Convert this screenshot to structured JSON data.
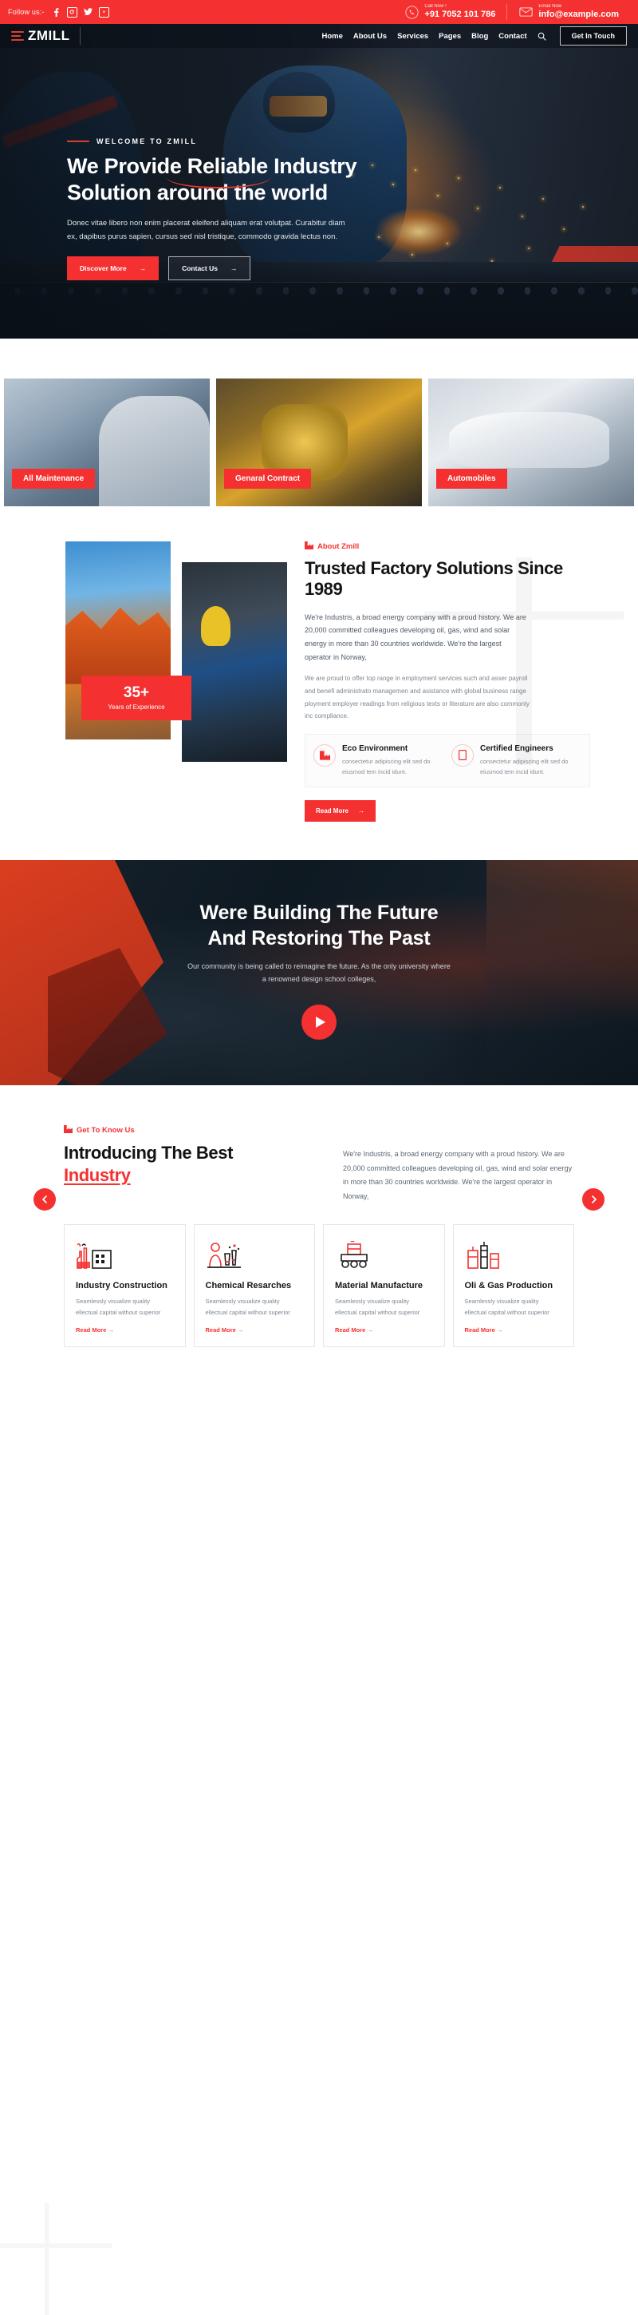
{
  "topbar": {
    "follow_label": "Follow us:-",
    "socials": [
      {
        "name": "facebook-icon",
        "glyph": "f"
      },
      {
        "name": "instagram-icon",
        "glyph": "◎"
      },
      {
        "name": "twitter-icon",
        "glyph": "🐦"
      },
      {
        "name": "youtube-icon",
        "glyph": "▶"
      }
    ],
    "call": {
      "icon": "phone-icon",
      "label": "Call Now !",
      "value": "+91 7052 101 786"
    },
    "email": {
      "icon": "envelope-icon",
      "label": "Email Now",
      "value": "info@example.com"
    }
  },
  "nav": {
    "logo": "ZMILL",
    "links": [
      "Home",
      "About Us",
      "Services",
      "Pages",
      "Blog",
      "Contact"
    ],
    "search_icon": "search-icon",
    "cta": "Get In Touch"
  },
  "hero": {
    "eyebrow": "WELCOME TO ZMILL",
    "title_line1": "We Provide Reliable Industry",
    "title_line2": "Solution around the world",
    "desc": "Donec vitae libero non enim placerat eleifend aliquam erat volutpat. Curabitur diam ex, dapibus purus sapien, cursus sed nisl tristique, commodo gravida lectus non.",
    "btn_primary": "Discover More",
    "btn_ghost": "Contact Us",
    "arrow": "→"
  },
  "strip": [
    {
      "label": "All Maintenance"
    },
    {
      "label": "Genaral Contract"
    },
    {
      "label": "Automobiles"
    }
  ],
  "about": {
    "eyebrow": "About Zmill",
    "eyebrow_icon": "factory-icon",
    "heading": "Trusted Factory Solutions Since 1989",
    "p1": "We're Industris, a broad energy company with a proud history. We are 20,000 committed colleagues developing oil, gas, wind and solar energy in more than 30 countries worldwide. We're the largest operator in Norway,",
    "p2": "We are proud to offer top range in employment services such and asser payroll and benefi administrato managemen and asistance with global business range ployment employer readings from religious texts or literature are also commonly inc compliance.",
    "badge_number": "35+",
    "badge_text": "Years of Experience",
    "features": [
      {
        "icon": "eco-factory-icon",
        "title": "Eco Environment",
        "desc": "consectetur adipiscing elit sed do eiusmod tem incid idunt."
      },
      {
        "icon": "certificate-icon",
        "title": "Certified Engineers",
        "desc": "consectetur adipiscing elit sed do eiusmod tem incid idunt."
      }
    ],
    "read_more": "Read More",
    "arrow": "→"
  },
  "cta": {
    "heading_line1": "Were Building The Future",
    "heading_line2": "And Restoring The Past",
    "desc": "Our community is being called to reimagine the future. As the only university where a renowned design school colleges,",
    "play_icon": "play-icon"
  },
  "intro": {
    "eyebrow": "Get To Know Us",
    "eyebrow_icon": "factory-icon",
    "heading_line1": "Introducing The Best",
    "heading_highlight": "Industry",
    "paragraph": "We're Industris, a broad energy company with a proud history. We are 20,000 committed colleagues developing oil, gas, wind and solar energy in more than 30 countries worldwide. We're the largest operator in Norway,",
    "prev_icon": "chevron-left-icon",
    "next_icon": "chevron-right-icon"
  },
  "services": [
    {
      "icon": "factory-plant-icon",
      "title": "Industry Construction",
      "desc": "Seamlessly visualize quality ellectual capital without superior",
      "link": "Read More →"
    },
    {
      "icon": "chemical-lab-icon",
      "title": "Chemical Resarches",
      "desc": "Seamlessly visualize quality ellectual capital without superior",
      "link": "Read More →"
    },
    {
      "icon": "conveyor-icon",
      "title": "Material Manufacture",
      "desc": "Seamlessly visualize quality ellectual capital without superior",
      "link": "Read More →"
    },
    {
      "icon": "oil-refinery-icon",
      "title": "Oli & Gas Production",
      "desc": "Seamlessly visualize quality ellectual capital without superior",
      "link": "Read More →"
    }
  ],
  "colors": {
    "accent": "#F53030",
    "dark": "#141414",
    "muted": "#7e8792"
  }
}
